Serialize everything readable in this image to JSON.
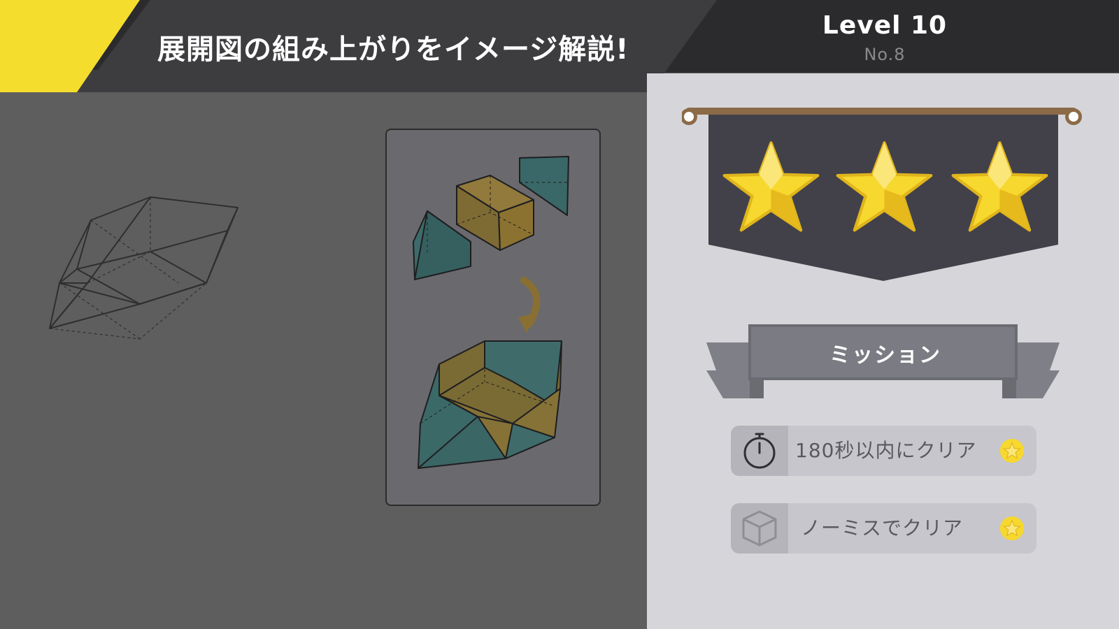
{
  "header": {
    "title": "展開図の組み上がりをイメージ解説!",
    "level": "Level 10",
    "number": "No.8"
  },
  "rating": {
    "stars_earned": 3,
    "stars_total": 3
  },
  "mission": {
    "label": "ミッション",
    "items": [
      {
        "icon": "stopwatch-icon",
        "text": "180秒以内にクリア",
        "achieved": true
      },
      {
        "icon": "cube-icon",
        "text": "ノーミスでクリア",
        "achieved": true
      }
    ]
  },
  "colors": {
    "accent_yellow": "#f5d81e",
    "banner_dark": "#2b2b2d",
    "hint_teal": "#3d6b6b",
    "hint_orange": "#8c7230"
  }
}
